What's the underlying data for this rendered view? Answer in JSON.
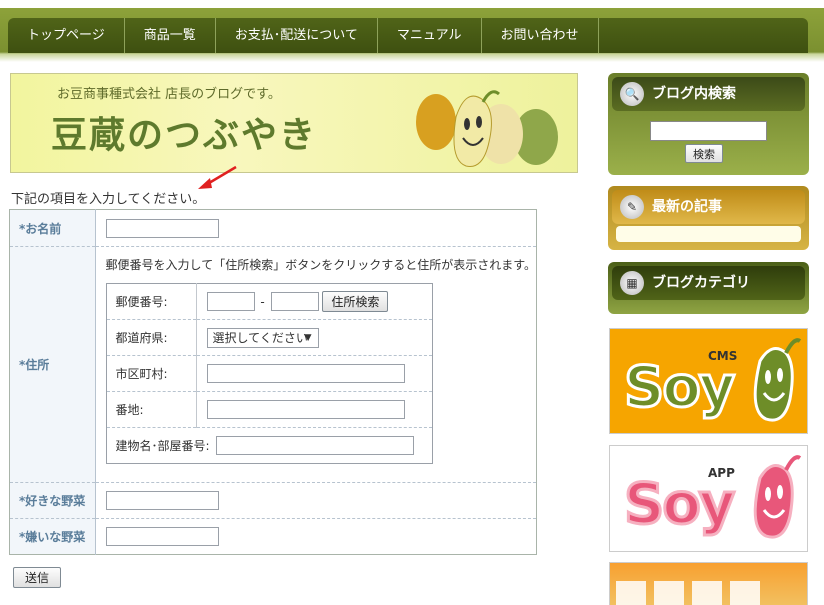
{
  "nav": {
    "items": [
      "トップページ",
      "商品一覧",
      "お支払･配送について",
      "マニュアル",
      "お問い合わせ"
    ]
  },
  "banner": {
    "subtitle": "お豆商事種式会社 店長のブログです。",
    "title": "豆蔵のつぶやき"
  },
  "form": {
    "intro": "下記の項目を入力してください。",
    "name_label": "*お名前",
    "address_label": "*住所",
    "address_note": "郵便番号を入力して「住所検索」ボタンをクリックすると住所が表示されます。",
    "postal_label": "郵便番号:",
    "postal_separator": "-",
    "address_search_button": "住所検索",
    "prefecture_label": "都道府県:",
    "prefecture_selected": "選択してください",
    "city_label": "市区町村:",
    "street_label": "番地:",
    "building_label": "建物名･部屋番号:",
    "favorite_label": "*好きな野菜",
    "disliked_label": "*嫌いな野菜",
    "submit_button": "送信"
  },
  "sidebar": {
    "search_title": "ブログ内検索",
    "search_button": "検索",
    "latest_title": "最新の記事",
    "category_title": "ブログカテゴリ"
  },
  "ads": {
    "cms_tag": "CMS",
    "cms_word": "Soy",
    "app_tag": "APP",
    "app_word": "Soy"
  },
  "colors": {
    "nav_bg": "#4a5c16",
    "label_text": "#5a7d9a",
    "cms_orange": "#f6a500",
    "app_pink": "#e8577a"
  }
}
